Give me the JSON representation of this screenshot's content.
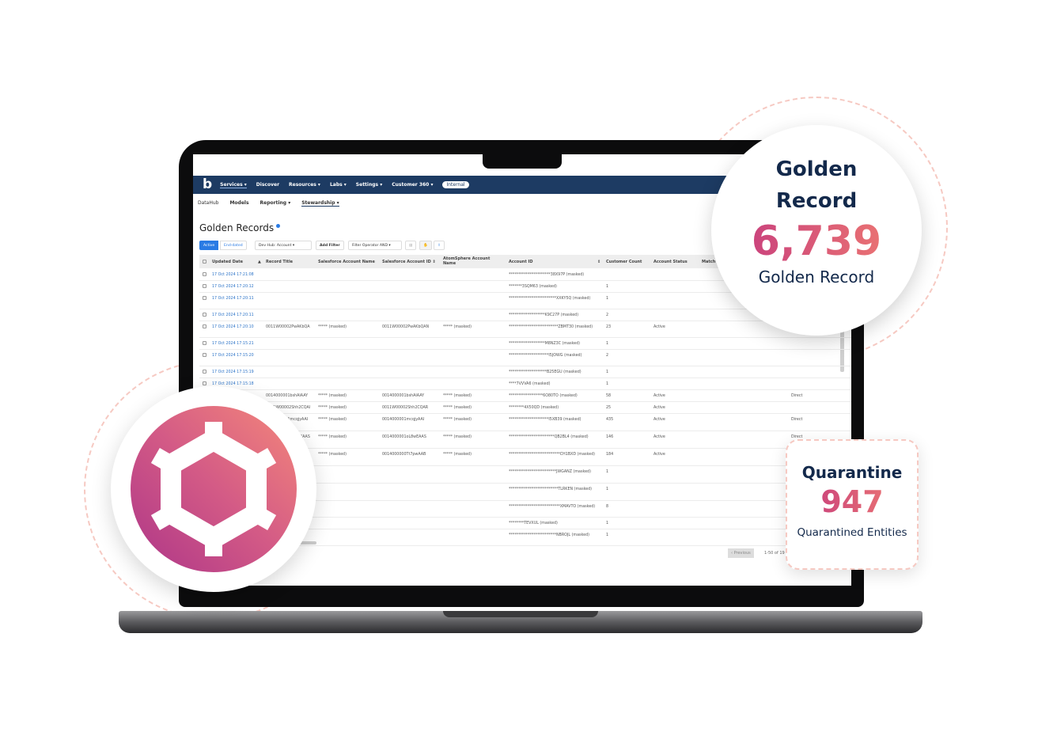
{
  "nav": {
    "items": [
      "Services ▾",
      "Discover",
      "Resources ▾",
      "Labs ▾",
      "Settings ▾",
      "Customer 360 ▾"
    ],
    "badge": "Internal"
  },
  "subnav": {
    "items": [
      "DataHub",
      "Models",
      "Reporting ▾",
      "Stewardship ▾"
    ]
  },
  "page": {
    "title": "Golden Records"
  },
  "toolbar": {
    "active": "Active",
    "end_dated": "End-dated",
    "hub_select": "Dev Hub: Account ▾",
    "add_filter": "Add Filter",
    "filter_operator": "Filter Operator AND ▾"
  },
  "table": {
    "columns": [
      "Updated Date",
      "▲",
      "Record Title",
      "Salesforce Account Name",
      "Salesforce Account ID ⇕",
      "AtomSphere Account Name",
      "Account ID",
      "⇕",
      "Customer Count",
      "Account Status",
      "Match"
    ],
    "rows": [
      {
        "date": "17 Oct 2024 17:21:08",
        "title": "",
        "sfname": "",
        "sfid": "",
        "asname": "",
        "accid": "**********************38X97P (masked)",
        "count": "",
        "status": "",
        "match": ""
      },
      {
        "date": "17 Oct 2024 17:20:12",
        "title": "",
        "sfname": "",
        "sfid": "",
        "asname": "",
        "accid": "*******3SQM63 (masked)",
        "count": "1",
        "status": "",
        "match": ""
      },
      {
        "date": "17 Oct 2024 17:20:11",
        "title": "",
        "sfname": "",
        "sfid": "",
        "asname": "",
        "accid": "*************************XXKY5Q (masked)",
        "count": "1",
        "status": "",
        "match": ""
      },
      {
        "date": "17 Oct 2024 17:20:11",
        "title": "",
        "sfname": "",
        "sfid": "",
        "asname": "",
        "accid": "*******************K9C27P (masked)",
        "count": "2",
        "status": "",
        "match": ""
      },
      {
        "date": "17 Oct 2024 17:20:10",
        "title": "0011W00002PwAKbQA",
        "sfname": "***** (masked)",
        "sfid": "0011W00002PwAKbQAN",
        "asname": "***** (masked)",
        "accid": "**************************ZBMT30 (masked)",
        "count": "23",
        "status": "Active",
        "match": ""
      },
      {
        "date": "17 Oct 2024 17:15:21",
        "title": "",
        "sfname": "",
        "sfid": "",
        "asname": "",
        "accid": "*******************M8NZ3C (masked)",
        "count": "1",
        "status": "",
        "match": ""
      },
      {
        "date": "17 Oct 2024 17:15:20",
        "title": "",
        "sfname": "",
        "sfid": "",
        "asname": "",
        "accid": "*********************I5JOWG (masked)",
        "count": "2",
        "status": "",
        "match": ""
      },
      {
        "date": "17 Oct 2024 17:15:19",
        "title": "",
        "sfname": "",
        "sfid": "",
        "asname": "",
        "accid": "********************B25EGU (masked)",
        "count": "1",
        "status": "",
        "match": ""
      },
      {
        "date": "17 Oct 2024 17:15:18",
        "title": "",
        "sfname": "",
        "sfid": "",
        "asname": "",
        "accid": "****7VVVA6 (masked)",
        "count": "1",
        "status": "",
        "match": ""
      },
      {
        "date": "",
        "title": "0014000001bshAIAAY",
        "sfname": "***** (masked)",
        "sfid": "0014000001bshAIAAY",
        "asname": "***** (masked)",
        "accid": "******************6O80TO (masked)",
        "count": "58",
        "status": "Active",
        "match": "Direct"
      },
      {
        "date": "",
        "title": "0011W00002Shh2CQAI",
        "sfname": "***** (masked)",
        "sfid": "0011W00002Shh2CQAR",
        "asname": "***** (masked)",
        "accid": "********4X50QD (masked)",
        "count": "25",
        "status": "Active",
        "match": ""
      },
      {
        "date": "",
        "title": "0014000001mcqjyAAI",
        "sfname": "***** (masked)",
        "sfid": "0014000001mcqjyAAI",
        "asname": "***** (masked)",
        "accid": "*********************I5XB39 (masked)",
        "count": "435",
        "status": "Active",
        "match": "Direct"
      },
      {
        "date": "",
        "title": "0014000001oL8wEAAS",
        "sfname": "***** (masked)",
        "sfid": "0014000001oL8wEAAS",
        "asname": "***** (masked)",
        "accid": "************************QB2BL4 (masked)",
        "count": "146",
        "status": "Active",
        "match": "Direct"
      },
      {
        "date": "",
        "title": "0014000000Tt7pwAAB",
        "sfname": "***** (masked)",
        "sfid": "0014000000Tt7pwAAB",
        "asname": "***** (masked)",
        "accid": "***************************CH1BXD (masked)",
        "count": "184",
        "status": "Active",
        "match": ""
      },
      {
        "date": "",
        "title": "",
        "sfname": "",
        "sfid": "",
        "asname": "",
        "accid": "*************************JWGANZ (masked)",
        "count": "1",
        "status": "",
        "match": ""
      },
      {
        "date": "",
        "title": "",
        "sfname": "",
        "sfid": "",
        "asname": "",
        "accid": "**************************TLRKEN (masked)",
        "count": "1",
        "status": "",
        "match": ""
      },
      {
        "date": "",
        "title": "",
        "sfname": "",
        "sfid": "",
        "asname": "",
        "accid": "***************************XMAVTO (masked)",
        "count": "8",
        "status": "",
        "match": ""
      },
      {
        "date": "",
        "title": "",
        "sfname": "",
        "sfid": "",
        "asname": "",
        "accid": "********TEVXUL (masked)",
        "count": "1",
        "status": "",
        "match": ""
      },
      {
        "date": "",
        "title": "",
        "sfname": "",
        "sfid": "",
        "asname": "",
        "accid": "*************************NBROJL (masked)",
        "count": "1",
        "status": "",
        "match": ""
      }
    ]
  },
  "pagination": {
    "previous": "‹ Previous",
    "range": "1-50 of 19"
  },
  "golden_card": {
    "heading_line1": "Golden",
    "heading_line2": "Record",
    "value": "6,739",
    "caption": "Golden Record"
  },
  "quarantine_card": {
    "heading": "Quarantine",
    "value": "947",
    "caption": "Quarantined Entities"
  },
  "colors": {
    "nav": "#1d3b63",
    "accent": "#2a7be4",
    "gradient_start": "#c2367f",
    "gradient_end": "#f27f70"
  },
  "icons": [
    "hexagon-gear-icon",
    "save-icon",
    "pointer-icon",
    "export-icon",
    "info-dot-icon"
  ]
}
